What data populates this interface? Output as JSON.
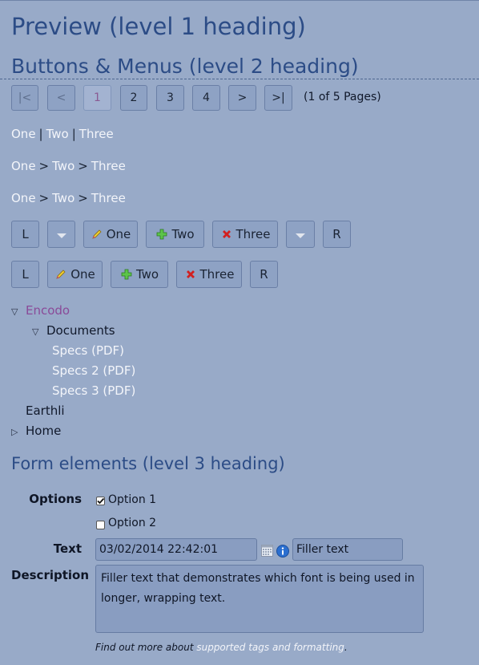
{
  "headings": {
    "h1": "Preview (level 1 heading)",
    "h2": "Buttons & Menus (level 2 heading)",
    "h3": "Form elements (level 3 heading)"
  },
  "pager": {
    "first": "|<",
    "prev": "<",
    "pages": [
      "1",
      "2",
      "3",
      "4"
    ],
    "current": "1",
    "next": ">",
    "last": ">|",
    "info": "(1 of 5 Pages)"
  },
  "breadcrumbs": [
    {
      "items": [
        "One",
        "Two",
        "Three"
      ],
      "separator": "|"
    },
    {
      "items": [
        "One",
        "Two",
        "Three"
      ],
      "separator": ">"
    },
    {
      "items": [
        "One",
        "Two",
        "Three"
      ],
      "separator": ">"
    }
  ],
  "button_row1": {
    "left": "L",
    "one": "One",
    "two": "Two",
    "three": "Three",
    "right": "R"
  },
  "button_row2": {
    "left": "L",
    "one": "One",
    "two": "Two",
    "three": "Three",
    "right": "R"
  },
  "tree": {
    "root": "Encodo",
    "folder": "Documents",
    "files": [
      "Specs (PDF)",
      "Specs 2 (PDF)",
      "Specs 3 (PDF)"
    ],
    "sibling": "Earthli",
    "home": "Home"
  },
  "form": {
    "options_label": "Options",
    "option1": "Option 1",
    "option1_checked": true,
    "option2": "Option 2",
    "option2_checked": false,
    "text_label": "Text",
    "date_value": "03/02/2014 22:42:01",
    "text_value": "Filler text",
    "description_label": "Description",
    "description_value": "Filler text that demonstrates which font is being used in longer, wrapping text.",
    "hint_prefix": "Find out more about ",
    "hint_link": "supported tags and formatting",
    "hint_suffix": "."
  },
  "icons": {
    "one": "pencil-icon",
    "two": "plus-icon",
    "three": "delete-x-icon",
    "calendar": "calendar-icon",
    "info": "info-icon"
  },
  "colors": {
    "background": "#98aac8",
    "heading": "#2c4c86",
    "link": "#f3f5fa",
    "visited": "#8a4a98"
  }
}
